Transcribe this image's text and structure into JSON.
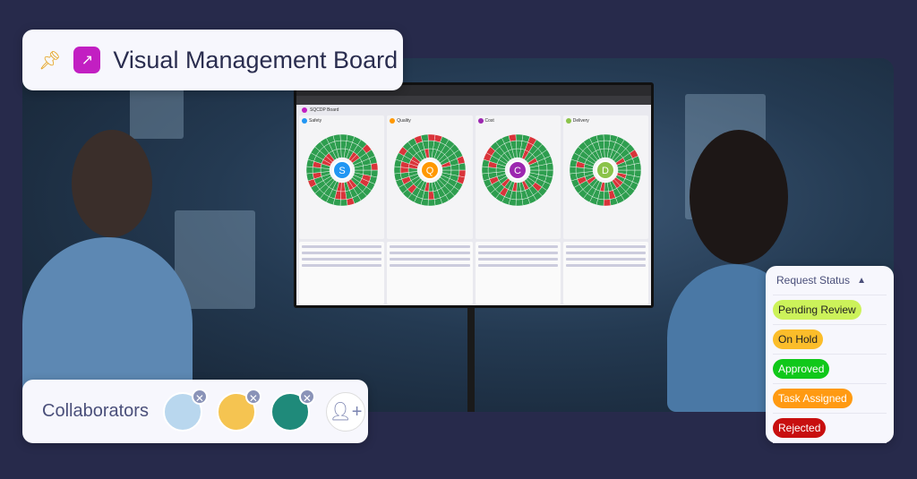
{
  "header": {
    "title": "Visual Management Board",
    "pin_icon": "pin-icon",
    "logo_icon": "chart-icon",
    "accent": "#c21fc2"
  },
  "board": {
    "title": "SQCDP Board",
    "panels": [
      {
        "label": "Safety",
        "letter": "S",
        "color": "#2196f3"
      },
      {
        "label": "Quality",
        "letter": "Q",
        "color": "#ff9800"
      },
      {
        "label": "Cost",
        "letter": "C",
        "color": "#9c27b0"
      },
      {
        "label": "Delivery",
        "letter": "D",
        "color": "#8bc34a"
      }
    ]
  },
  "collaborators": {
    "label": "Collaborators",
    "avatars": [
      {
        "bg": "#b9d7ee"
      },
      {
        "bg": "#f5c451"
      },
      {
        "bg": "#1f8a7a"
      }
    ],
    "add_icon": "add-user-icon"
  },
  "status": {
    "header": "Request Status",
    "sort_icon": "sort-icon",
    "items": [
      {
        "label": "Pending Review",
        "bg": "#ccf25a",
        "fg": "#222"
      },
      {
        "label": "On Hold",
        "bg": "#fbbd2a",
        "fg": "#222"
      },
      {
        "label": "Approved",
        "bg": "#10c81a",
        "fg": "#fff"
      },
      {
        "label": "Task Assigned",
        "bg": "#ff9a12",
        "fg": "#fff"
      },
      {
        "label": "Rejected",
        "bg": "#c80f0f",
        "fg": "#fff"
      }
    ]
  }
}
